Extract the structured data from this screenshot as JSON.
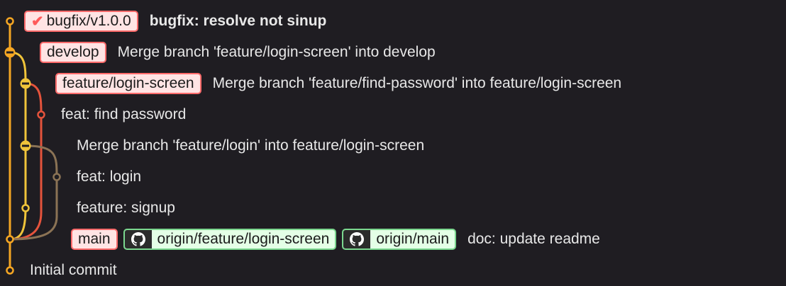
{
  "commits": [
    {
      "message": "bugfix: resolve not sinup",
      "tag": "bugfix/v1.0.0"
    },
    {
      "message": "Merge branch 'feature/login-screen' into develop",
      "branch": "develop"
    },
    {
      "message": "Merge branch 'feature/find-password' into feature/login-screen",
      "branch": "feature/login-screen"
    },
    {
      "message": "feat: find password"
    },
    {
      "message": "Merge branch 'feature/login' into feature/login-screen"
    },
    {
      "message": "feat: login"
    },
    {
      "message": "feature: signup"
    },
    {
      "message": "doc: update readme",
      "branches": [
        "main",
        "origin/feature/login-screen",
        "origin/main"
      ]
    },
    {
      "message": "Initial commit"
    }
  ],
  "colors": {
    "lane_main": "#f5a623",
    "lane_develop": "#f5a623",
    "lane_feature": "#f0c43a",
    "lane_find_password": "#e5533c",
    "lane_login": "#8b7355",
    "badge_local_border": "#ff6b6b",
    "badge_remote_border": "#7bd88f"
  },
  "icons": {
    "tag_check": "check-icon",
    "remote": "github-icon"
  }
}
